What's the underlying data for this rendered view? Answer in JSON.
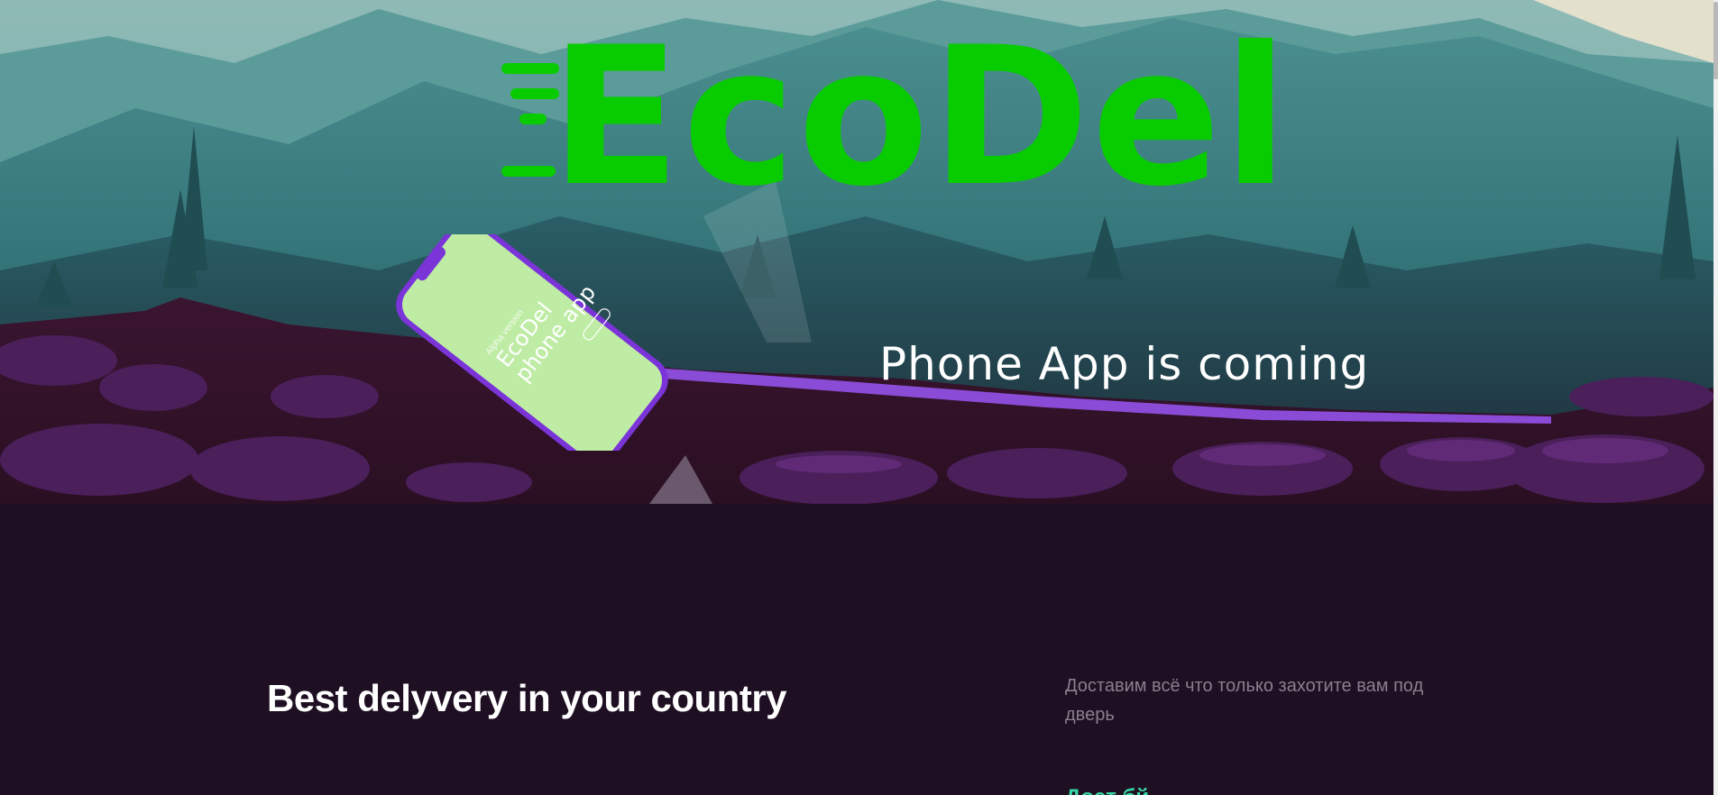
{
  "hero": {
    "logo_text": "EcoDel",
    "tagline": "Phone App is coming",
    "phone": {
      "version_label": "Alpha version",
      "title_line1": "EcoDel",
      "title_line2": "phone app"
    }
  },
  "content": {
    "headline": "Best delyvery in your country",
    "description": "Доставим всё что только захотите вам под дверь",
    "link_partial": "Дост бй"
  },
  "colors": {
    "brand_green": "#08cc00",
    "background_dark": "#1e0f22",
    "accent_purple": "#8a4bd6",
    "link_teal": "#37d6a4"
  }
}
